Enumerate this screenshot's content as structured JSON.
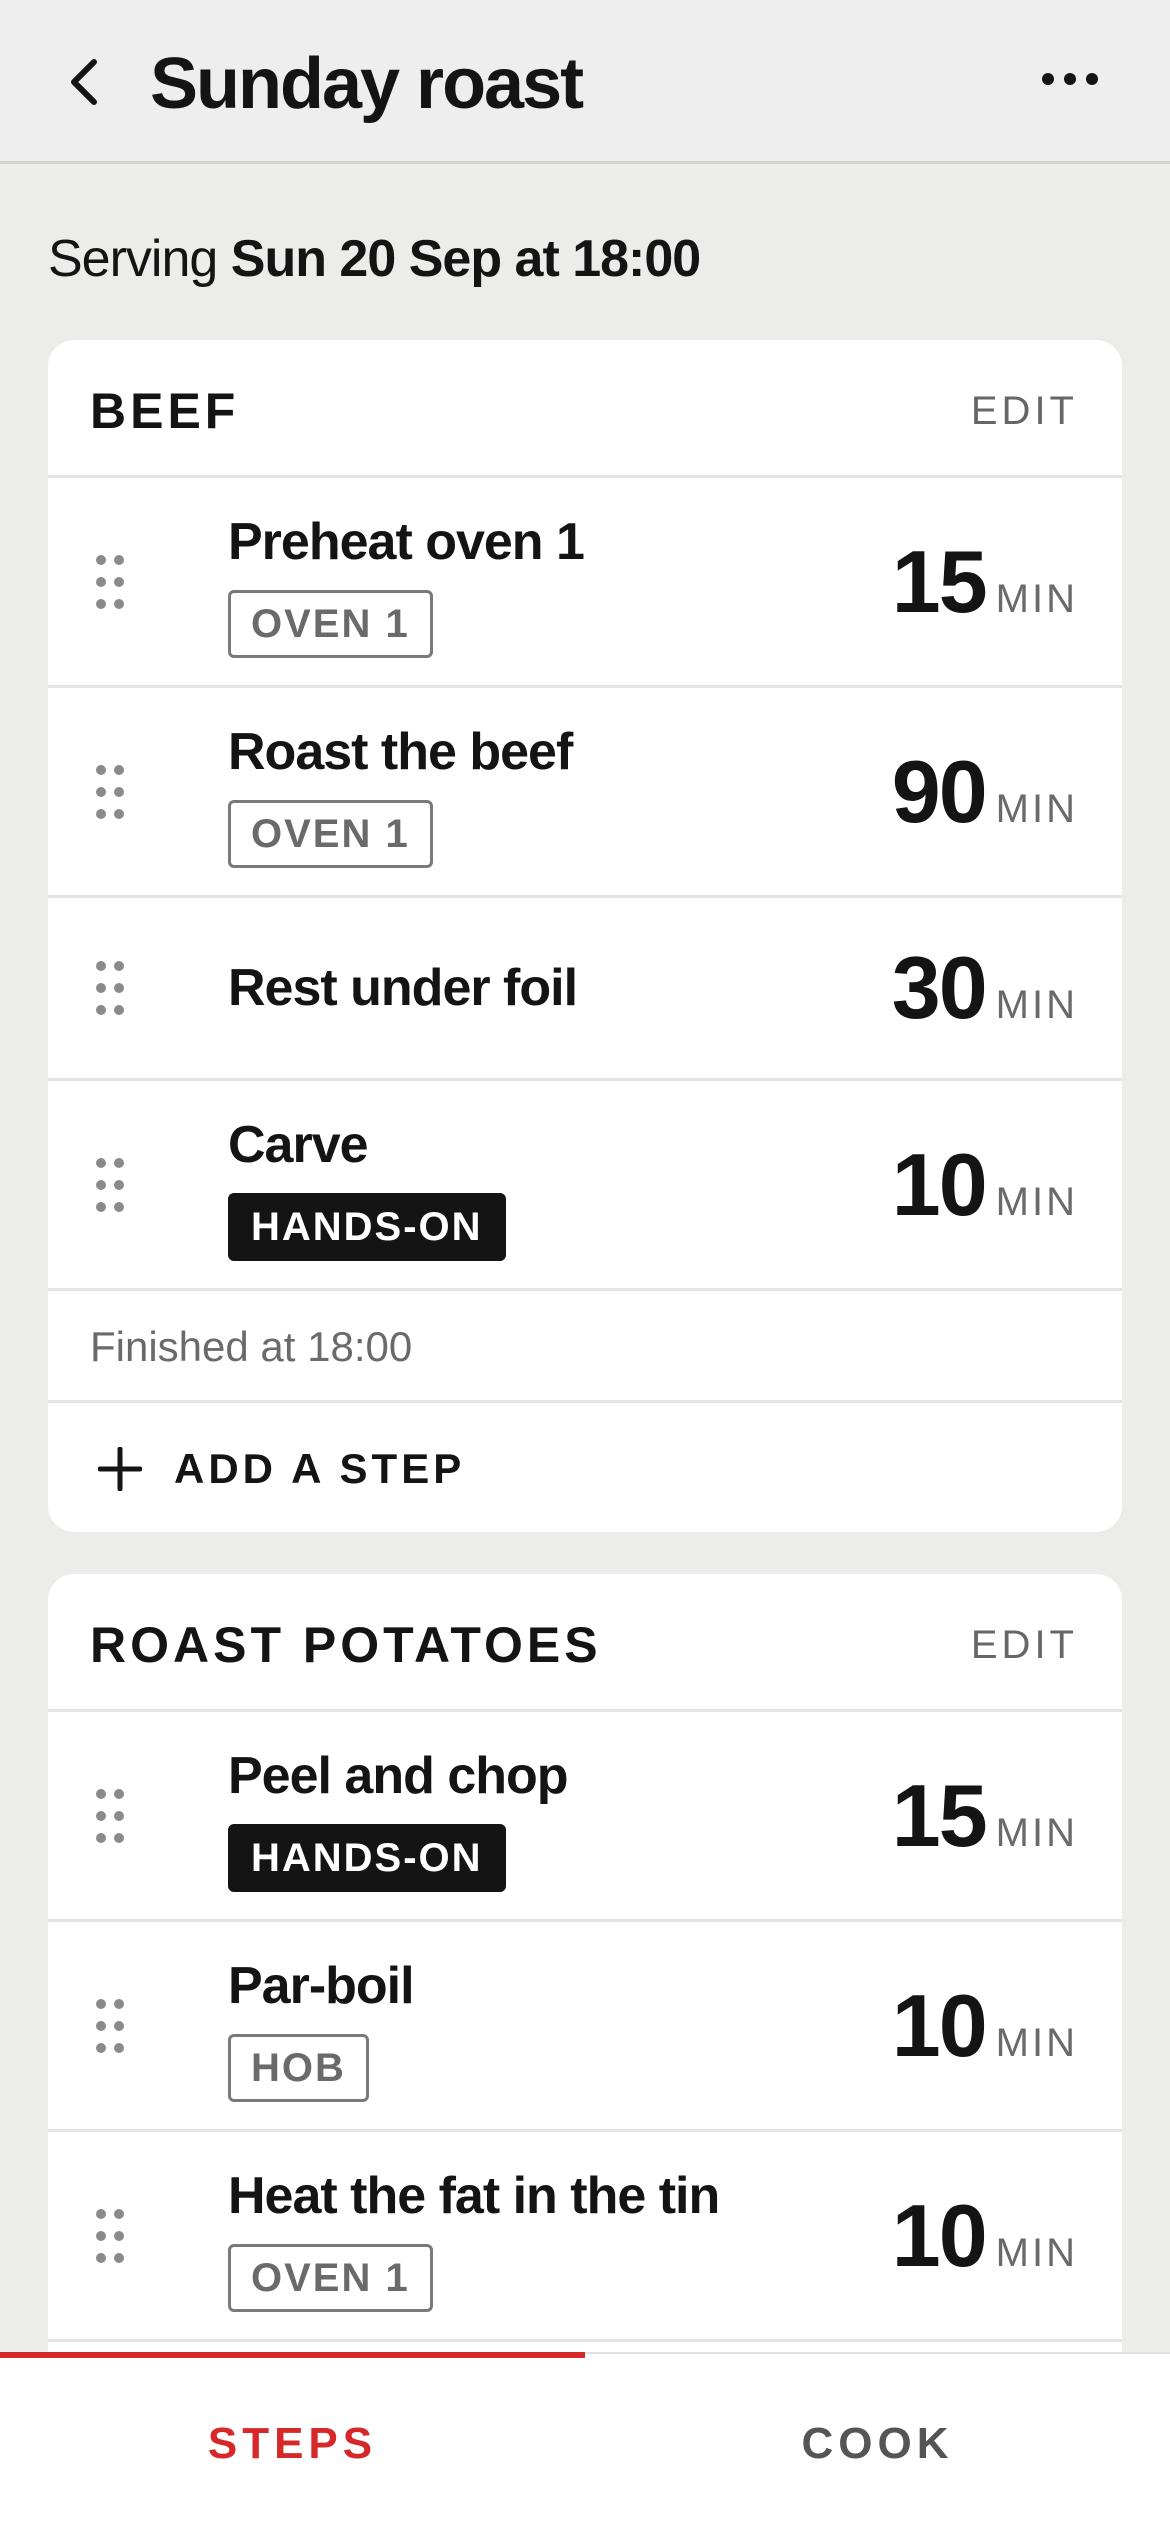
{
  "header": {
    "title": "Sunday roast",
    "back_icon": "chevron-left-icon",
    "more_icon": "more-horizontal-icon"
  },
  "serving": {
    "prefix": "Serving",
    "datetime": "Sun 20 Sep at 18:00"
  },
  "groups": [
    {
      "title": "BEEF",
      "edit_label": "EDIT",
      "steps": [
        {
          "title": "Preheat oven 1",
          "tag": "OVEN 1",
          "tag_style": "outline",
          "duration": "15",
          "unit": "MIN"
        },
        {
          "title": "Roast the beef",
          "tag": "OVEN 1",
          "tag_style": "outline",
          "duration": "90",
          "unit": "MIN"
        },
        {
          "title": "Rest under foil",
          "tag": "",
          "tag_style": "none",
          "duration": "30",
          "unit": "MIN"
        },
        {
          "title": "Carve",
          "tag": "HANDS-ON",
          "tag_style": "filled",
          "duration": "10",
          "unit": "MIN"
        }
      ],
      "finished_text": "Finished at 18:00",
      "add_step_label": "ADD A STEP"
    },
    {
      "title": "ROAST POTATOES",
      "edit_label": "EDIT",
      "steps": [
        {
          "title": "Peel and chop",
          "tag": "HANDS-ON",
          "tag_style": "filled",
          "duration": "15",
          "unit": "MIN"
        },
        {
          "title": "Par-boil",
          "tag": "HOB",
          "tag_style": "outline",
          "duration": "10",
          "unit": "MIN"
        },
        {
          "title": "Heat the fat in the tin",
          "tag": "OVEN 1",
          "tag_style": "outline",
          "duration": "10",
          "unit": "MIN"
        }
      ]
    }
  ],
  "tabs": [
    {
      "label": "STEPS",
      "active": true
    },
    {
      "label": "COOK",
      "active": false
    }
  ],
  "colors": {
    "accent": "#d62828",
    "background": "#ececeb",
    "card": "#ffffff",
    "text": "#141414",
    "muted": "#6a6a6a"
  }
}
